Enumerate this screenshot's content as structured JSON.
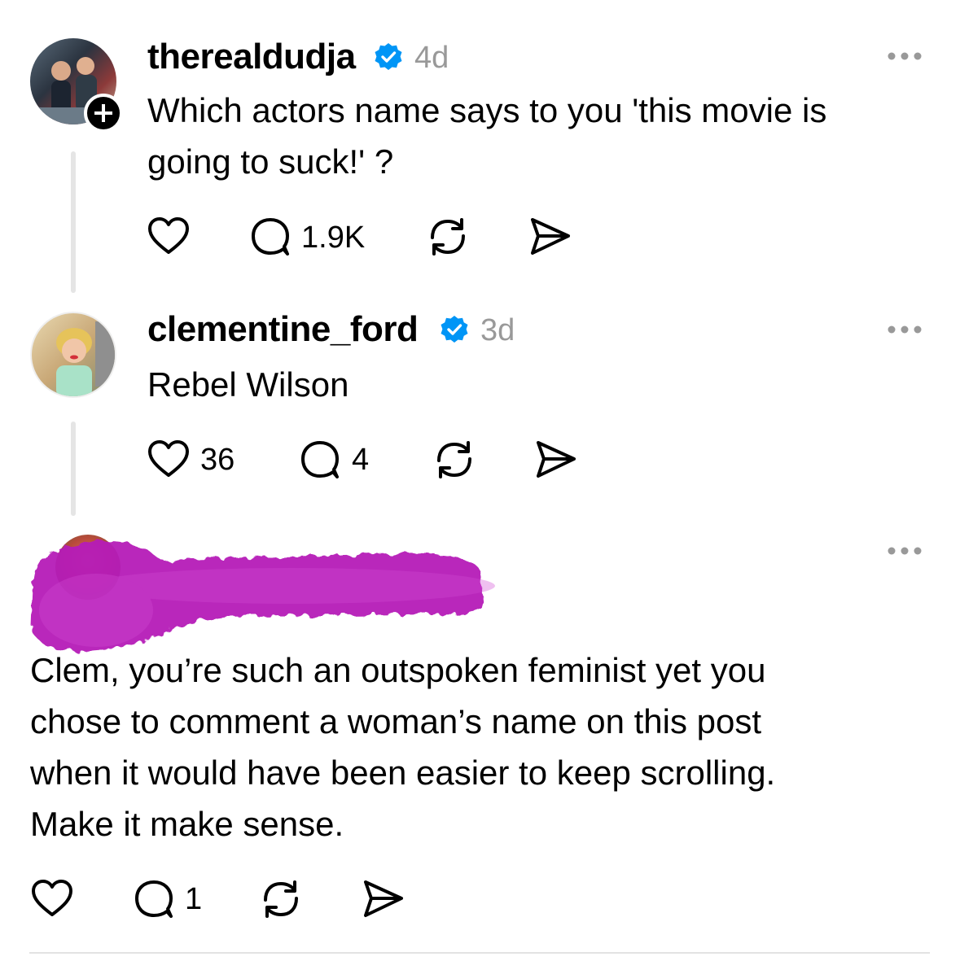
{
  "posts": [
    {
      "username": "therealdudja",
      "time": "4d",
      "text": "Which actors name says to you 'this movie is going to suck!' ?",
      "text_lines": [
        "Which actors name says to you 'this movie is",
        "going to suck!' ?"
      ],
      "reply_count": "1.9K",
      "icons": [
        "heart-icon",
        "comment-icon",
        "repost-icon",
        "share-icon"
      ]
    },
    {
      "username": "clementine_ford",
      "time": "3d",
      "text": "Rebel Wilson",
      "like_count": "36",
      "reply_count": "4",
      "icons": [
        "heart-icon",
        "comment-icon",
        "repost-icon",
        "share-icon"
      ]
    },
    {
      "username_redacted": true,
      "text_lines": [
        "Clem, you’re such an outspoken feminist yet you",
        "chose to comment a woman’s name on this post",
        "when it would have been easier to keep scrolling.",
        "Make it make sense."
      ],
      "reply_count": "1",
      "icons": [
        "heart-icon",
        "comment-icon",
        "repost-icon",
        "share-icon"
      ]
    }
  ],
  "colors": {
    "verified": "#0095f6",
    "muted_text": "#999999",
    "thread_line": "#e5e5e5",
    "redaction": "#b61fb8"
  }
}
